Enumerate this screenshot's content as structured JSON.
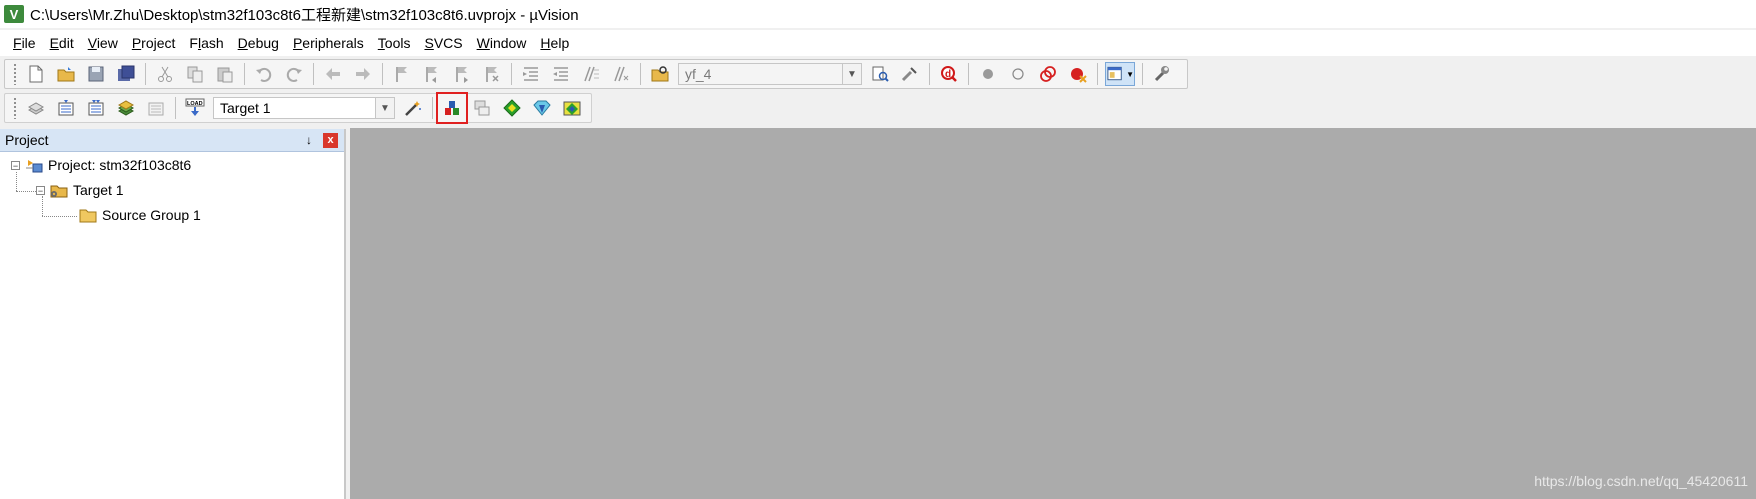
{
  "window": {
    "title": "C:\\Users\\Mr.Zhu\\Desktop\\stm32f103c8t6工程新建\\stm32f103c8t6.uvprojx - µVision",
    "app_icon_letter": "V"
  },
  "menu": [
    {
      "label": "File",
      "accel": "F",
      "rest": "ile"
    },
    {
      "label": "Edit",
      "accel": "E",
      "rest": "dit"
    },
    {
      "label": "View",
      "accel": "V",
      "rest": "iew"
    },
    {
      "label": "Project",
      "accel": "P",
      "rest": "roject"
    },
    {
      "label": "Flash",
      "pre": "F",
      "accel": "l",
      "rest": "ash"
    },
    {
      "label": "Debug",
      "accel": "D",
      "rest": "ebug"
    },
    {
      "label": "Peripherals",
      "accel": "P",
      "rest": "eripherals"
    },
    {
      "label": "Tools",
      "accel": "T",
      "rest": "ools"
    },
    {
      "label": "SVCS",
      "accel": "S",
      "rest": "VCS"
    },
    {
      "label": "Window",
      "accel": "W",
      "rest": "indow"
    },
    {
      "label": "Help",
      "accel": "H",
      "rest": "elp"
    }
  ],
  "toolbar1": {
    "find_combo_value": "yf_4"
  },
  "toolbar2": {
    "target_combo_value": "Target 1",
    "load_icon_text": "LOAD"
  },
  "project_panel": {
    "title": "Project",
    "pin_glyph": "↓",
    "close_glyph": "x",
    "tree": {
      "project": "Project: stm32f103c8t6",
      "target": "Target 1",
      "group": "Source Group 1"
    }
  },
  "watermark": "https://blog.csdn.net/qq_45420611",
  "colors": {
    "editor_bg": "#ababab",
    "panel_header": "#d7e5f5",
    "highlight": "#e02020"
  }
}
